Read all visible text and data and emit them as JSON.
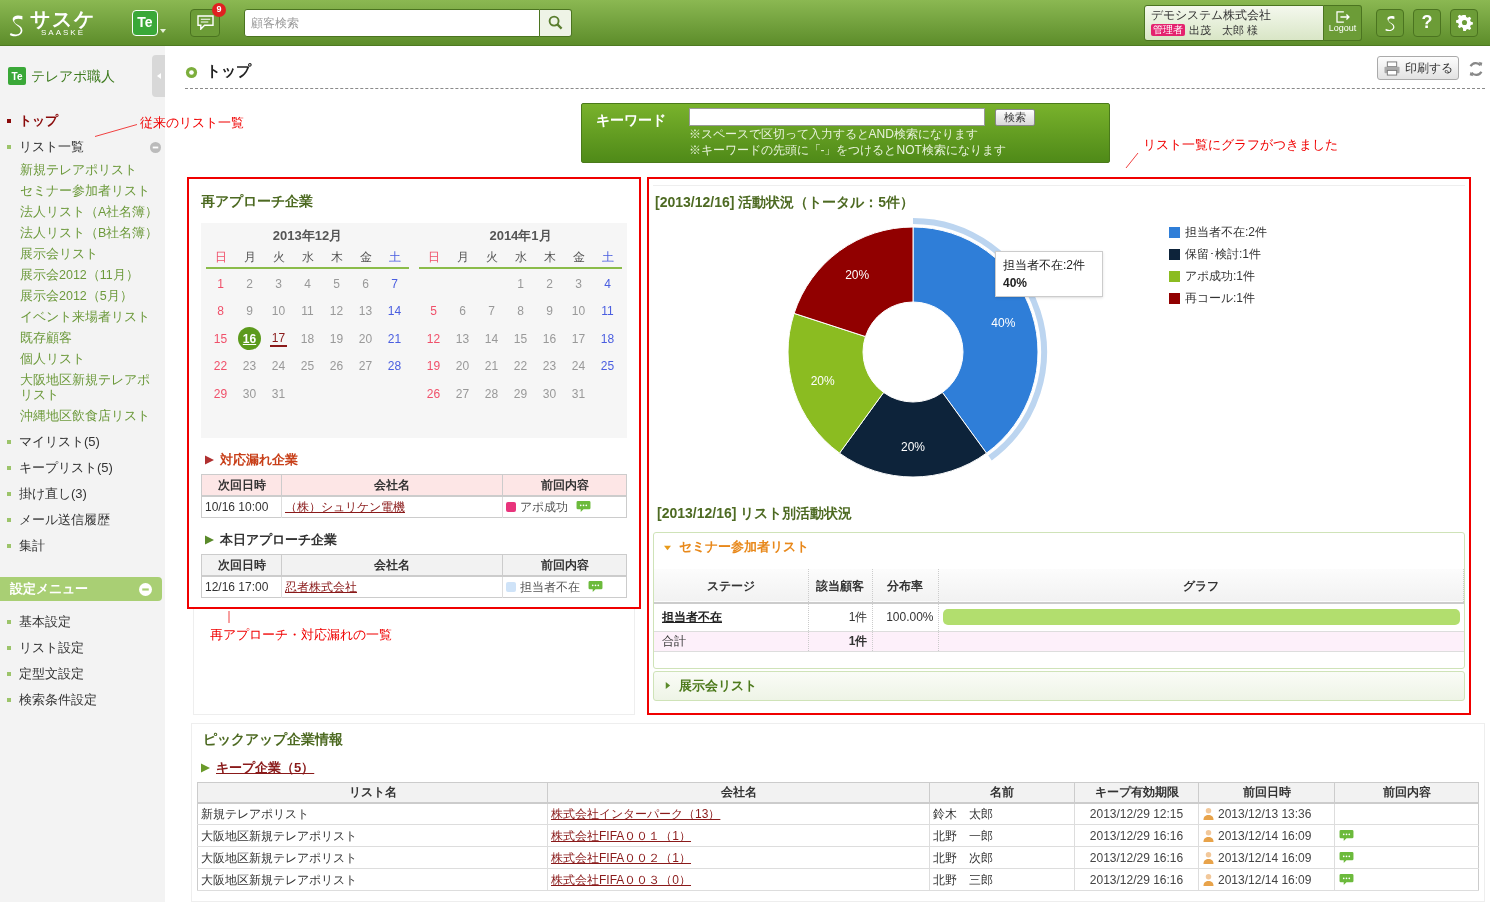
{
  "header": {
    "logo": "サスケ",
    "logo_sub": "SAASKE",
    "app_badge": "Te",
    "notification_count": "9",
    "search": {
      "placeholder": "顧客検索"
    },
    "user": {
      "company": "デモシステム株式会社",
      "role": "管理者",
      "name": "出茂　太郎 様"
    },
    "logout": "Logout",
    "help": "?"
  },
  "sidebar": {
    "app_badge": "Te",
    "app_name": "テレアポ職人",
    "nav": [
      {
        "label": "トップ",
        "selected": true
      },
      {
        "label": "リスト一覧",
        "selected": false,
        "expanded": true,
        "children": [
          {
            "label": "新規テレアポリスト",
            "selected": false
          },
          {
            "label": "セミナー参加者リスト",
            "selected": false
          },
          {
            "label": "法人リスト（A社名簿）",
            "selected": false
          },
          {
            "label": "法人リスト（B社名簿）",
            "selected": false
          },
          {
            "label": "展示会リスト",
            "selected": false
          },
          {
            "label": "展示会2012（11月）",
            "selected": false
          },
          {
            "label": "展示会2012（5月）",
            "selected": false
          },
          {
            "label": "イベント来場者リスト",
            "selected": false
          },
          {
            "label": "既存顧客",
            "selected": false
          },
          {
            "label": "個人リスト",
            "selected": false
          },
          {
            "label": "大阪地区新規テレアポリスト",
            "selected": false
          },
          {
            "label": "沖縄地区飲食店リスト",
            "selected": false
          }
        ]
      },
      {
        "label": "マイリスト(5)",
        "selected": false
      },
      {
        "label": "キープリスト(5)",
        "selected": false
      },
      {
        "label": "掛け直し(3)",
        "selected": false
      },
      {
        "label": "メール送信履歴",
        "selected": false
      },
      {
        "label": "集計",
        "selected": false
      }
    ],
    "settings": {
      "title": "設定メニュー",
      "expanded": true,
      "items": [
        {
          "label": "基本設定",
          "selected": false
        },
        {
          "label": "リスト設定",
          "selected": false
        },
        {
          "label": "定型文設定",
          "selected": false
        },
        {
          "label": "検索条件設定",
          "selected": false
        }
      ]
    }
  },
  "page": {
    "title": "トップ",
    "print_button": "印刷する"
  },
  "keyword": {
    "label": "キーワード",
    "button": "検索",
    "hints": [
      "※スペースで区切って入力するとAND検索になります",
      "※キーワードの先頭に「-」をつけるとNOT検索になります"
    ]
  },
  "annotations": {
    "list_note": "従来のリスト一覧",
    "graph_note": "リスト一覧にグラフがつきました",
    "reapproach_note": "再アプローチ・対応漏れの一覧"
  },
  "reapproach": {
    "title": "再アプローチ企業",
    "calendars": [
      {
        "title": "2013年12月",
        "weekdays": [
          "日",
          "月",
          "火",
          "水",
          "木",
          "金",
          "土"
        ],
        "weeks": [
          {
            "kind": "left",
            "days": [
              "1",
              "2",
              "3",
              "4",
              "5",
              "6",
              "7"
            ]
          },
          {
            "kind": "left",
            "days": [
              "8",
              "9",
              "10",
              "11",
              "12",
              "13",
              "14"
            ]
          },
          {
            "kind": "left",
            "days": [
              "15",
              {
                "day": "16",
                "today": true
              },
              {
                "day": "17",
                "marked": true
              },
              "18",
              "19",
              "20",
              "21"
            ]
          },
          {
            "kind": "left",
            "days": [
              "22",
              "23",
              "24",
              "25",
              "26",
              "27",
              "28"
            ]
          },
          {
            "kind": "left",
            "days": [
              "29",
              "30",
              "31"
            ]
          }
        ]
      },
      {
        "title": "2014年1月",
        "weekdays": [
          "日",
          "月",
          "火",
          "水",
          "木",
          "金",
          "土"
        ],
        "weeks": [
          {
            "kind": "right",
            "days": [
              "1",
              "2",
              "3",
              "4"
            ]
          },
          {
            "kind": "left",
            "days": [
              "5",
              "6",
              "7",
              "8",
              "9",
              "10",
              "11"
            ]
          },
          {
            "kind": "left",
            "days": [
              "12",
              "13",
              "14",
              "15",
              "16",
              "17",
              "18"
            ]
          },
          {
            "kind": "left",
            "days": [
              "19",
              "20",
              "21",
              "22",
              "23",
              "24",
              "25"
            ]
          },
          {
            "kind": "left",
            "days": [
              "26",
              "27",
              "28",
              "29",
              "30",
              "31"
            ]
          }
        ]
      }
    ],
    "tables": [
      {
        "kind": "missed",
        "title": "対応漏れ企業",
        "columns": [
          "次回日時",
          "会社名",
          "前回内容"
        ],
        "rows": [
          {
            "datetime": "10/16 10:00",
            "company": "（株）シュリケン電機",
            "status": "アポ成功",
            "color": "#e8347c",
            "memo": true
          }
        ]
      },
      {
        "kind": "today",
        "title": "本日アプローチ企業",
        "columns": [
          "次回日時",
          "会社名",
          "前回内容"
        ],
        "rows": [
          {
            "datetime": "12/16 17:00",
            "company": "忍者株式会社",
            "status": "担当者不在",
            "color": "#cfe3f8",
            "memo": true
          }
        ]
      }
    ]
  },
  "activity": {
    "title": "[2013/12/16] 活動状況（トータル：5件）",
    "chart_data": {
      "type": "donut",
      "categories": [
        "担当者不在:2件",
        "保留･検討:1件",
        "アポ成功:1件",
        "再コール:1件"
      ],
      "values": [
        40,
        20,
        20,
        20
      ],
      "value_labels": [
        "40%",
        "20%",
        "20%",
        "20%"
      ]
    },
    "slices": [
      {
        "color": "#2f7ed8",
        "hovered": true
      },
      {
        "color": "#0d233a",
        "hovered": false
      },
      {
        "color": "#8bbc21",
        "hovered": false
      },
      {
        "color": "#910000",
        "hovered": false
      }
    ],
    "tooltip": {
      "title": "担当者不在:2件",
      "value": "40%"
    }
  },
  "list_activity": {
    "title": "[2013/12/16] リスト別活動状況",
    "sections": [
      {
        "name": "セミナー参加者リスト",
        "expanded": true,
        "columns": [
          "ステージ",
          "該当顧客",
          "分布率",
          "グラフ"
        ],
        "rows": [
          {
            "stage": "担当者不在",
            "count": "1件",
            "rate": "100.00%",
            "level": 1
          }
        ],
        "total": {
          "label": "合計",
          "count": "1件"
        }
      },
      {
        "name": "展示会リスト",
        "expanded": false
      }
    ]
  },
  "pickup": {
    "title": "ピックアップ企業情報",
    "keep_link": "キープ企業（5）",
    "columns": [
      "リスト名",
      "会社名",
      "名前",
      "キープ有効期限",
      "前回日時",
      "前回内容"
    ],
    "rows": [
      {
        "list": "新規テレアポリスト",
        "company": "株式会社インターパーク（13）",
        "name": "鈴木　太郎",
        "expiry": "2013/12/29 12:15",
        "last": "2013/12/13 13:36",
        "memo": false
      },
      {
        "list": "大阪地区新規テレアポリスト",
        "company": "株式会社FIFA００１（1）",
        "name": "北野　一郎",
        "expiry": "2013/12/29 16:16",
        "last": "2013/12/14 16:09",
        "memo": true
      },
      {
        "list": "大阪地区新規テレアポリスト",
        "company": "株式会社FIFA００２（1）",
        "name": "北野　次郎",
        "expiry": "2013/12/29 16:16",
        "last": "2013/12/14 16:09",
        "memo": true
      },
      {
        "list": "大阪地区新規テレアポリスト",
        "company": "株式会社FIFA００３（0）",
        "name": "北野　三郎",
        "expiry": "2013/12/29 16:16",
        "last": "2013/12/14 16:09",
        "memo": true
      }
    ]
  }
}
